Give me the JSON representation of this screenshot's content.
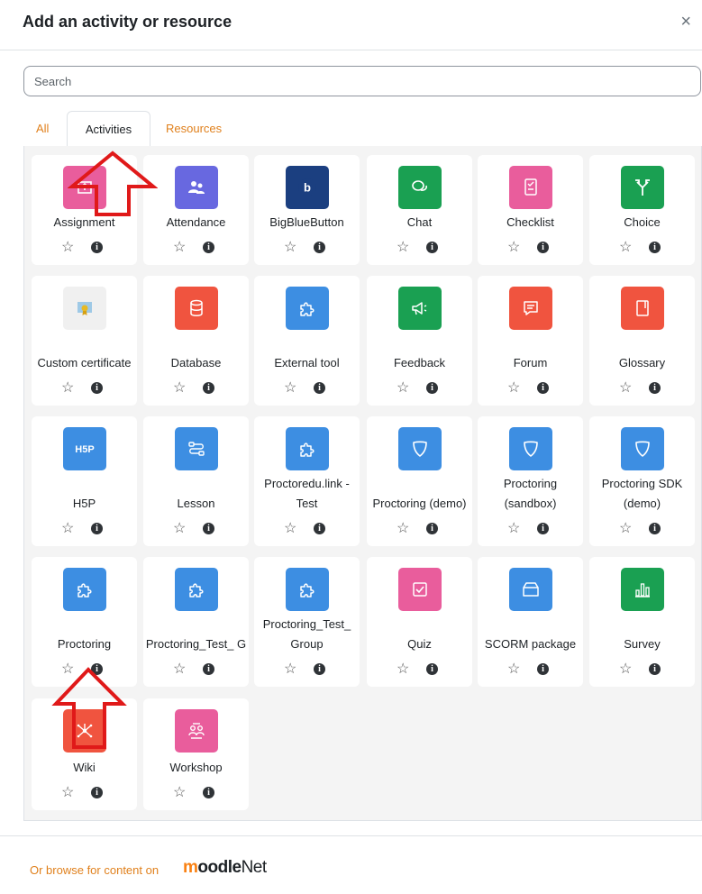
{
  "modal": {
    "title": "Add an activity or resource",
    "close": "×"
  },
  "search": {
    "placeholder": "Search"
  },
  "tabs": {
    "all": "All",
    "activities": "Activities",
    "resources": "Resources",
    "active": "Activities"
  },
  "activities": [
    {
      "name": "Assignment",
      "icon": "assignment-icon",
      "color": "#e95d9c"
    },
    {
      "name": "Attendance",
      "icon": "attendance-icon",
      "color": "#6868e0"
    },
    {
      "name": "BigBlueButton",
      "icon": "bigbluebutton-icon",
      "color": "#1b3f80"
    },
    {
      "name": "Chat",
      "icon": "chat-icon",
      "color": "#1aa052"
    },
    {
      "name": "Checklist",
      "icon": "checklist-icon",
      "color": "#e95d9c"
    },
    {
      "name": "Choice",
      "icon": "choice-icon",
      "color": "#1aa052"
    },
    {
      "name": "Custom certificate",
      "icon": "certificate-icon",
      "color": "#f0f0f0"
    },
    {
      "name": "Database",
      "icon": "database-icon",
      "color": "#f0543f"
    },
    {
      "name": "External tool",
      "icon": "puzzle-icon",
      "color": "#3d8ee2"
    },
    {
      "name": "Feedback",
      "icon": "megaphone-icon",
      "color": "#1aa052"
    },
    {
      "name": "Forum",
      "icon": "forum-icon",
      "color": "#f0543f"
    },
    {
      "name": "Glossary",
      "icon": "glossary-icon",
      "color": "#f0543f"
    },
    {
      "name": "H5P",
      "icon": "h5p-icon",
      "color": "#3d8ee2"
    },
    {
      "name": "Lesson",
      "icon": "lesson-icon",
      "color": "#3d8ee2"
    },
    {
      "name": "Proctoredu.link - Test",
      "icon": "puzzle-icon",
      "color": "#3d8ee2"
    },
    {
      "name": "Proctoring (demo)",
      "icon": "shield-icon",
      "color": "#3d8ee2"
    },
    {
      "name": "Proctoring (sandbox)",
      "icon": "shield-icon",
      "color": "#3d8ee2"
    },
    {
      "name": "Proctoring SDK (demo)",
      "icon": "shield-icon",
      "color": "#3d8ee2"
    },
    {
      "name": "Proctoring",
      "icon": "puzzle-icon",
      "color": "#3d8ee2"
    },
    {
      "name": "Proctoring_Test_ G",
      "icon": "puzzle-icon",
      "color": "#3d8ee2"
    },
    {
      "name": "Proctoring_Test_ Group",
      "icon": "puzzle-icon",
      "color": "#3d8ee2"
    },
    {
      "name": "Quiz",
      "icon": "quiz-icon",
      "color": "#e95d9c"
    },
    {
      "name": "SCORM package",
      "icon": "package-icon",
      "color": "#3d8ee2"
    },
    {
      "name": "Survey",
      "icon": "bar-chart-icon",
      "color": "#1aa052"
    },
    {
      "name": "Wiki",
      "icon": "wiki-icon",
      "color": "#f0543f"
    },
    {
      "name": "Workshop",
      "icon": "workshop-icon",
      "color": "#e95d9c"
    }
  ],
  "footer": {
    "browse_text": "Or browse for content on",
    "brand_m": "m",
    "brand_oodle": "oodle",
    "brand_net": "Net"
  }
}
